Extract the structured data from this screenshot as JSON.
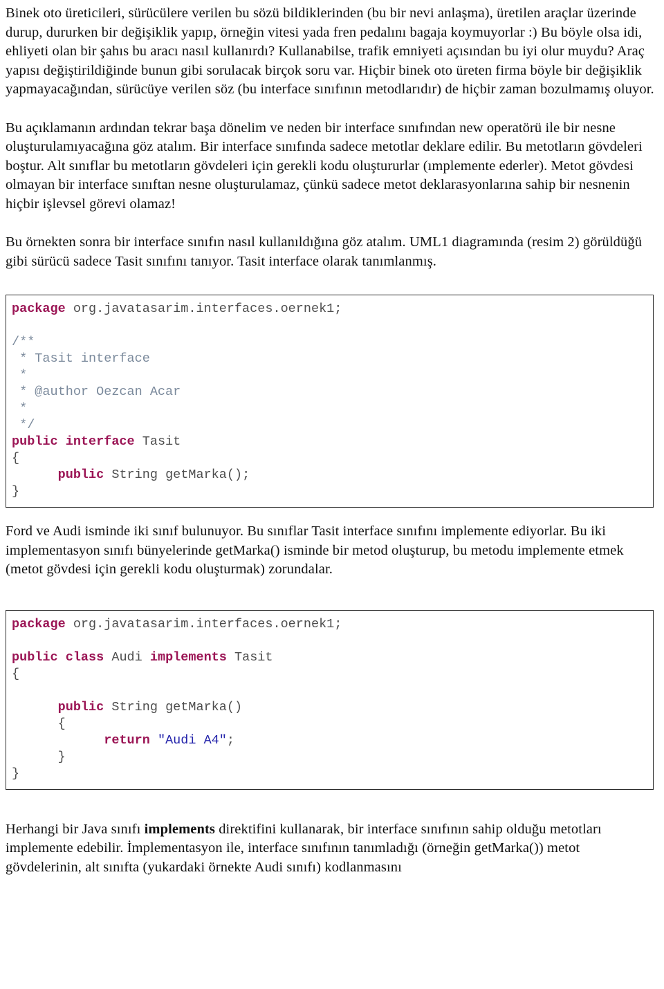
{
  "document": {
    "language": "tr",
    "colors": {
      "keyword": "#9b1555",
      "comment": "#7b8a9c",
      "string": "#2222aa",
      "code_text": "#4d4d4d",
      "body_text": "#111111",
      "code_border": "#2b2b2b",
      "background": "#ffffff"
    },
    "paragraphs": {
      "p1": "Binek oto üreticileri, sürücülere verilen bu sözü bildiklerinden (bu bir nevi anlaşma), üretilen araçlar üzerinde durup, dururken bir değişiklik yapıp, örneğin vitesi yada fren pedalını bagaja koymuyorlar :) Bu böyle olsa idi, ehliyeti olan bir şahıs bu aracı nasıl kullanırdı? Kullanabilse, trafik emniyeti açısından bu iyi olur muydu? Araç yapısı değiştirildiğinde bunun gibi sorulacak birçok soru var. Hiçbir binek oto üreten firma böyle bir değişiklik yapmayacağından, sürücüye verilen söz (bu interface sınıfının metodlarıdır) de hiçbir zaman bozulmamış oluyor.",
      "p2": "Bu açıklamanın ardından tekrar başa dönelim ve neden bir interface sınıfından new operatörü ile bir nesne oluşturulamıyacağına göz atalım. Bir interface sınıfında sadece metotlar deklare edilir. Bu metotların gövdeleri boştur. Alt sınıflar bu metotların gövdeleri için gerekli kodu oluştururlar (ımplemente ederler). Metot gövdesi olmayan bir interface sınıftan nesne oluşturulamaz, çünkü sadece metot deklarasyonlarına sahip bir nesnenin hiçbir işlevsel görevi olamaz!",
      "p3": "Bu örnekten sonra bir interface sınıfın nasıl kullanıldığına göz atalım. UML1 diagramında (resim 2) görüldüğü gibi sürücü sadece Tasit sınıfını tanıyor. Tasit interface olarak tanımlanmış.",
      "p4": "Ford ve Audi isminde iki sınıf bulunuyor. Bu sınıflar Tasit interface sınıfını implemente ediyorlar. Bu iki implementasyon sınıfı bünyelerinde getMarka() isminde bir metod oluşturup, bu metodu  implemente etmek (metot gövdesi için gerekli kodu oluşturmak) zorundalar.",
      "p5_part1": "Herhangi bir Java sınıfı ",
      "p5_bold": "implements",
      "p5_part2": " direktifini kullanarak, bir interface sınıfının sahip olduğu metotları implemente edebilir. İmplementasyon ile, interface sınıfının tanımladığı (örneğin getMarka()) metot gövdelerinin, alt sınıfta (yukardaki örnekte Audi sınıfı) kodlanmasını"
    },
    "code_blocks": [
      {
        "id": "tasit-interface",
        "language": "java",
        "lines": [
          {
            "tokens": [
              {
                "t": "package",
                "c": "kw"
              },
              {
                "t": " org.javatasarim.interfaces.oernek1;",
                "c": "plain"
              }
            ]
          },
          {
            "tokens": [
              {
                "t": "",
                "c": "plain"
              }
            ]
          },
          {
            "tokens": [
              {
                "t": "/**",
                "c": "cmt"
              }
            ]
          },
          {
            "tokens": [
              {
                "t": " * Tasit interface",
                "c": "cmt"
              }
            ]
          },
          {
            "tokens": [
              {
                "t": " *",
                "c": "cmt"
              }
            ]
          },
          {
            "tokens": [
              {
                "t": " * @author Oezcan Acar",
                "c": "cmt"
              }
            ]
          },
          {
            "tokens": [
              {
                "t": " *",
                "c": "cmt"
              }
            ]
          },
          {
            "tokens": [
              {
                "t": " */",
                "c": "cmt"
              }
            ]
          },
          {
            "tokens": [
              {
                "t": "public interface",
                "c": "kw"
              },
              {
                "t": " Tasit",
                "c": "plain"
              }
            ]
          },
          {
            "tokens": [
              {
                "t": "{",
                "c": "plain"
              }
            ]
          },
          {
            "tokens": [
              {
                "t": "      ",
                "c": "plain"
              },
              {
                "t": "public",
                "c": "kw"
              },
              {
                "t": " String getMarka();",
                "c": "plain"
              }
            ]
          },
          {
            "tokens": [
              {
                "t": "}",
                "c": "plain"
              }
            ]
          }
        ]
      },
      {
        "id": "audi-class",
        "language": "java",
        "lines": [
          {
            "tokens": [
              {
                "t": "package",
                "c": "kw"
              },
              {
                "t": " org.javatasarim.interfaces.oernek1;",
                "c": "plain"
              }
            ]
          },
          {
            "tokens": [
              {
                "t": "",
                "c": "plain"
              }
            ]
          },
          {
            "tokens": [
              {
                "t": "public class",
                "c": "kw"
              },
              {
                "t": " Audi ",
                "c": "plain"
              },
              {
                "t": "implements",
                "c": "kw"
              },
              {
                "t": " Tasit",
                "c": "plain"
              }
            ]
          },
          {
            "tokens": [
              {
                "t": "{",
                "c": "plain"
              }
            ]
          },
          {
            "tokens": [
              {
                "t": "",
                "c": "plain"
              }
            ]
          },
          {
            "tokens": [
              {
                "t": "      ",
                "c": "plain"
              },
              {
                "t": "public",
                "c": "kw"
              },
              {
                "t": " String getMarka()",
                "c": "plain"
              }
            ]
          },
          {
            "tokens": [
              {
                "t": "      {",
                "c": "plain"
              }
            ]
          },
          {
            "tokens": [
              {
                "t": "            ",
                "c": "plain"
              },
              {
                "t": "return",
                "c": "kw"
              },
              {
                "t": " ",
                "c": "plain"
              },
              {
                "t": "\"Audi A4\"",
                "c": "str"
              },
              {
                "t": ";",
                "c": "plain"
              }
            ]
          },
          {
            "tokens": [
              {
                "t": "      }",
                "c": "plain"
              }
            ]
          },
          {
            "tokens": [
              {
                "t": "}",
                "c": "plain"
              }
            ]
          }
        ]
      }
    ]
  }
}
